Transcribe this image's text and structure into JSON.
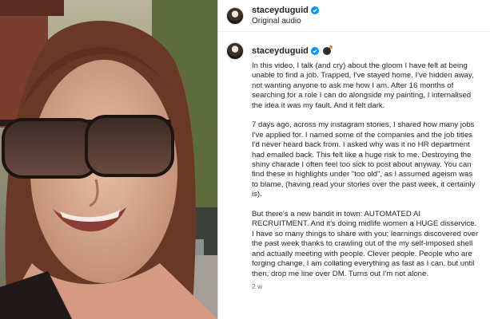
{
  "colors": {
    "verified": "#0095f6",
    "text": "#262626",
    "muted": "#737373"
  },
  "post": {
    "username": "staceyduguid",
    "audio_label": "Original audio",
    "verified_icon": "verified-badge-icon",
    "emoji_icon": "bomb-icon",
    "caption_paragraphs": [
      "In this video, I talk (and cry) about the gloom I have felt at being unable to find a job. Trapped, I've stayed home. I've hidden away, not wanting anyone to ask me how I am. After 16 months of searching for a role I can do alongside my painting, I internalised the idea it was my fault. And it felt dark.",
      "7 days ago, across my instagram stories, I shared how many jobs I've applied for. I named some of the companies and the job titles I'd never heard back from. I asked why was it no HR department had emailed back. This felt like a huge risk to me. Destroying the shiny charade I often feel too sick to post about anyway. You can find these in highlights under \"too old\", as I assumed ageism was to blame, (having read your stories over the past week, it certainly is).",
      "But there's a new bandit in town: AUTOMATED AI RECRUITMENT. And it's doing midlife women a HUGE disservice.",
      "I have so many things to share with you; learnings discovered over the past week thanks to crawling out of the my self-imposed shell and actually meeting with people. Clever people. People who are forging change. I am collating everything as fast as I can, but until then, drop me line over DM. Turns out I'm not alone."
    ],
    "timestamp": "2 w"
  }
}
